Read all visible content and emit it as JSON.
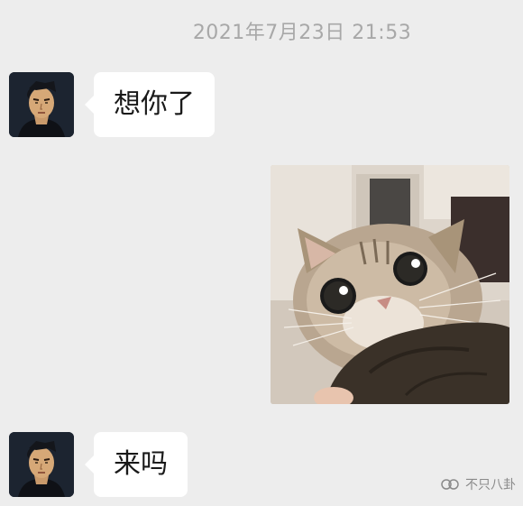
{
  "timestamp": "2021年7月23日 21:53",
  "messages": [
    {
      "type": "text",
      "sender": "contact",
      "text": "想你了"
    },
    {
      "type": "image",
      "sender": "me",
      "content": "cat-photo"
    },
    {
      "type": "text",
      "sender": "contact",
      "text": "来吗"
    }
  ],
  "watermark": {
    "text": "不只八卦"
  },
  "colors": {
    "background": "#ededed",
    "bubble": "#ffffff",
    "timestamp": "#a8a8a8",
    "text": "#191919"
  }
}
